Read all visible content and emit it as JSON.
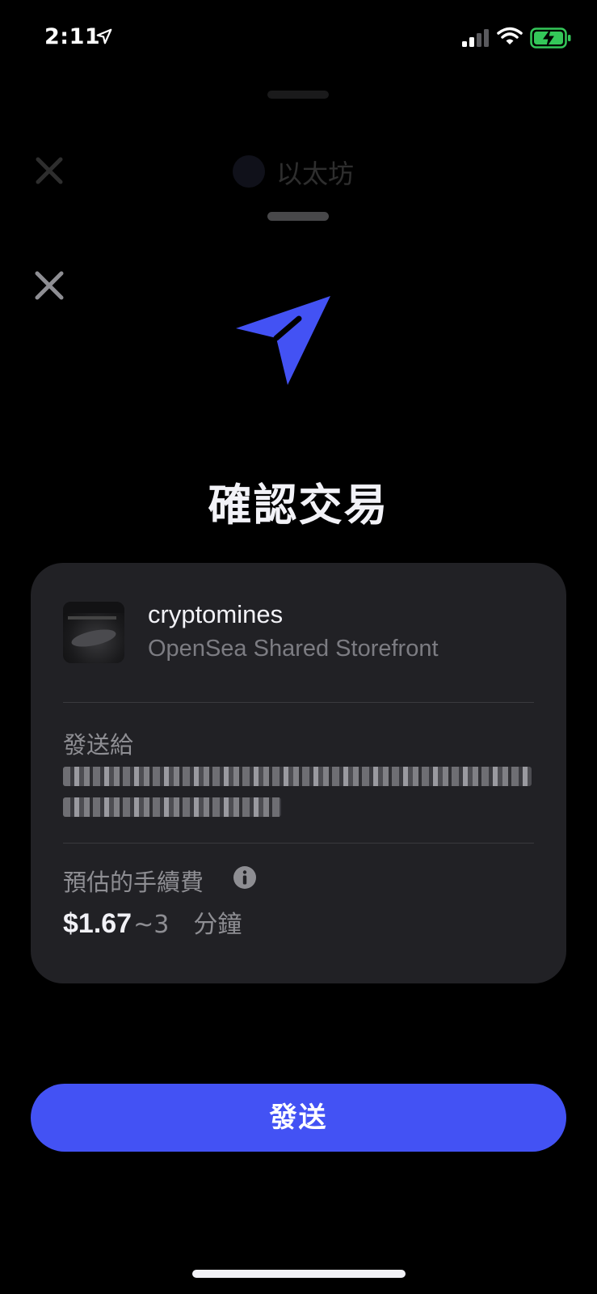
{
  "status_bar": {
    "time": "2:11",
    "icons": [
      "location-arrow-icon",
      "cellular-signal-icon",
      "wifi-icon",
      "battery-charging-icon"
    ],
    "battery_color": "#34c759"
  },
  "background_sheet": {
    "title": "以太坊",
    "icons": [
      "close-icon",
      "ethereum-icon"
    ]
  },
  "sheet": {
    "title": "確認交易",
    "hero_icon": "send-arrow-icon",
    "accent_color": "#4352f4",
    "asset": {
      "name": "cryptomines",
      "collection": "OpenSea Shared Storefront"
    },
    "recipient": {
      "label": "發送給"
    },
    "fee": {
      "label": "預估的手續費",
      "amount": "$1.67",
      "time": "~3　分鐘"
    },
    "send_button_label": "發送"
  }
}
